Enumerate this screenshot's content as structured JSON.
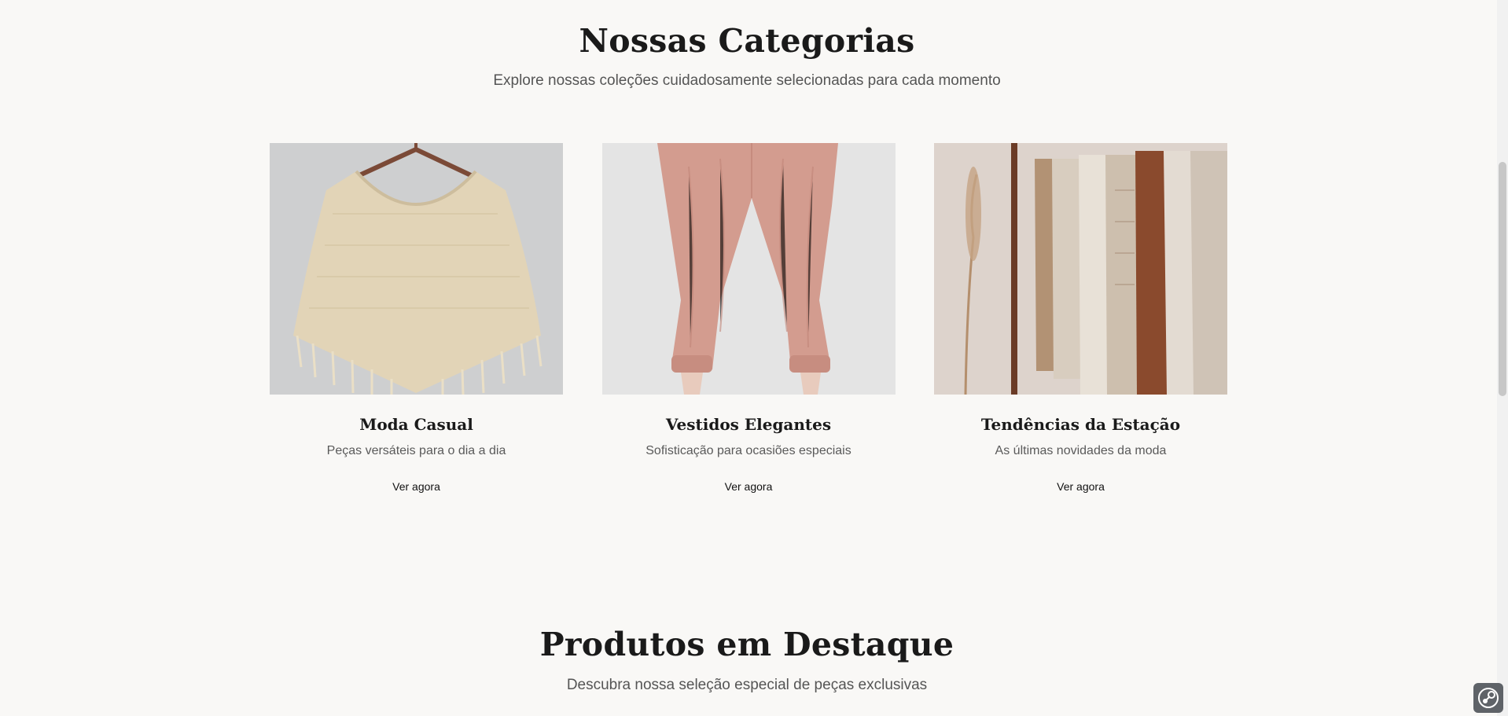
{
  "categories_section": {
    "title": "Nossas Categorias",
    "subtitle": "Explore nossas coleções cuidadosamente selecionadas para cada momento",
    "cards": [
      {
        "title": "Moda Casual",
        "description": "Peças versáteis para o dia a dia",
        "link_label": "Ver agora",
        "image_subject": "beige-knit-poncho-on-hanger"
      },
      {
        "title": "Vestidos Elegantes",
        "description": "Sofisticação para ocasiões especiais",
        "link_label": "Ver agora",
        "image_subject": "pink-jogger-pants"
      },
      {
        "title": "Tendências da Estação",
        "description": "As últimas novidades da moda",
        "link_label": "Ver agora",
        "image_subject": "clothing-rack-with-pampas-grass"
      }
    ]
  },
  "featured_section": {
    "title": "Produtos em Destaque",
    "subtitle": "Descubra nossa seleção especial de peças exclusivas"
  },
  "icons": {
    "corner_badge": "steam-icon"
  },
  "colors": {
    "background": "#f9f8f6",
    "heading": "#1a1a1a",
    "muted_text": "#555555"
  }
}
